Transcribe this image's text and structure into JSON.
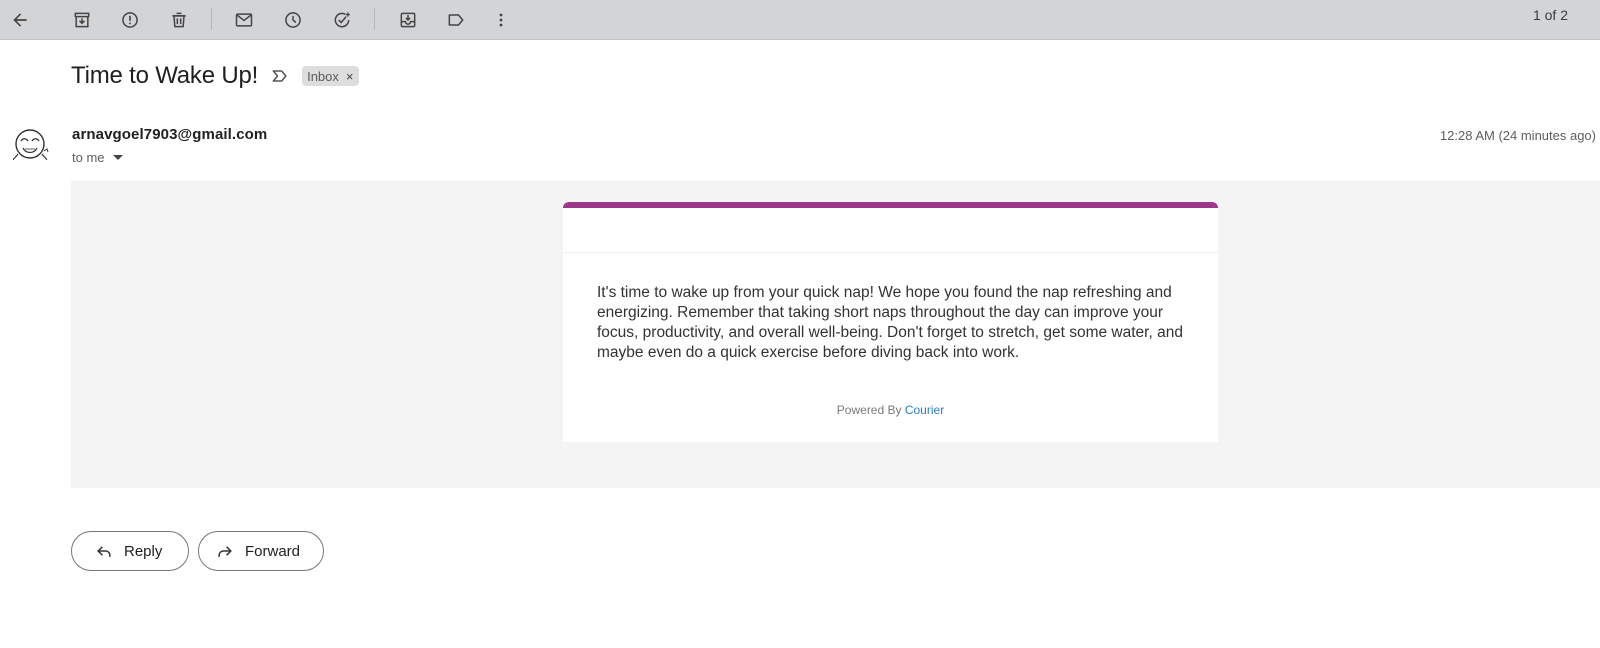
{
  "toolbar": {
    "icons": [
      "back-arrow-icon",
      "archive-icon",
      "report-spam-icon",
      "delete-icon",
      "mark-unread-icon",
      "snooze-icon",
      "add-task-icon",
      "move-to-icon",
      "label-icon",
      "more-vert-icon"
    ],
    "pager": "1 of 2"
  },
  "message": {
    "subject": "Time to Wake Up!",
    "label": "Inbox",
    "label_remove": "×",
    "sender": "arnavgoel7903@gmail.com",
    "recipient": "to me",
    "timestamp": "12:28 AM (24 minutes ago)"
  },
  "email_body": {
    "accent_color": "#9d3789",
    "text": "It's time to wake up from your quick nap! We hope you found the nap refreshing and energizing. Remember that taking short naps throughout the day can improve your focus, productivity, and overall well-being. Don't forget to stretch, get some water, and maybe even do a quick exercise before diving back into work.",
    "powered_by": "Powered By",
    "powered_link": "Courier"
  },
  "actions": {
    "reply": "Reply",
    "forward": "Forward"
  }
}
